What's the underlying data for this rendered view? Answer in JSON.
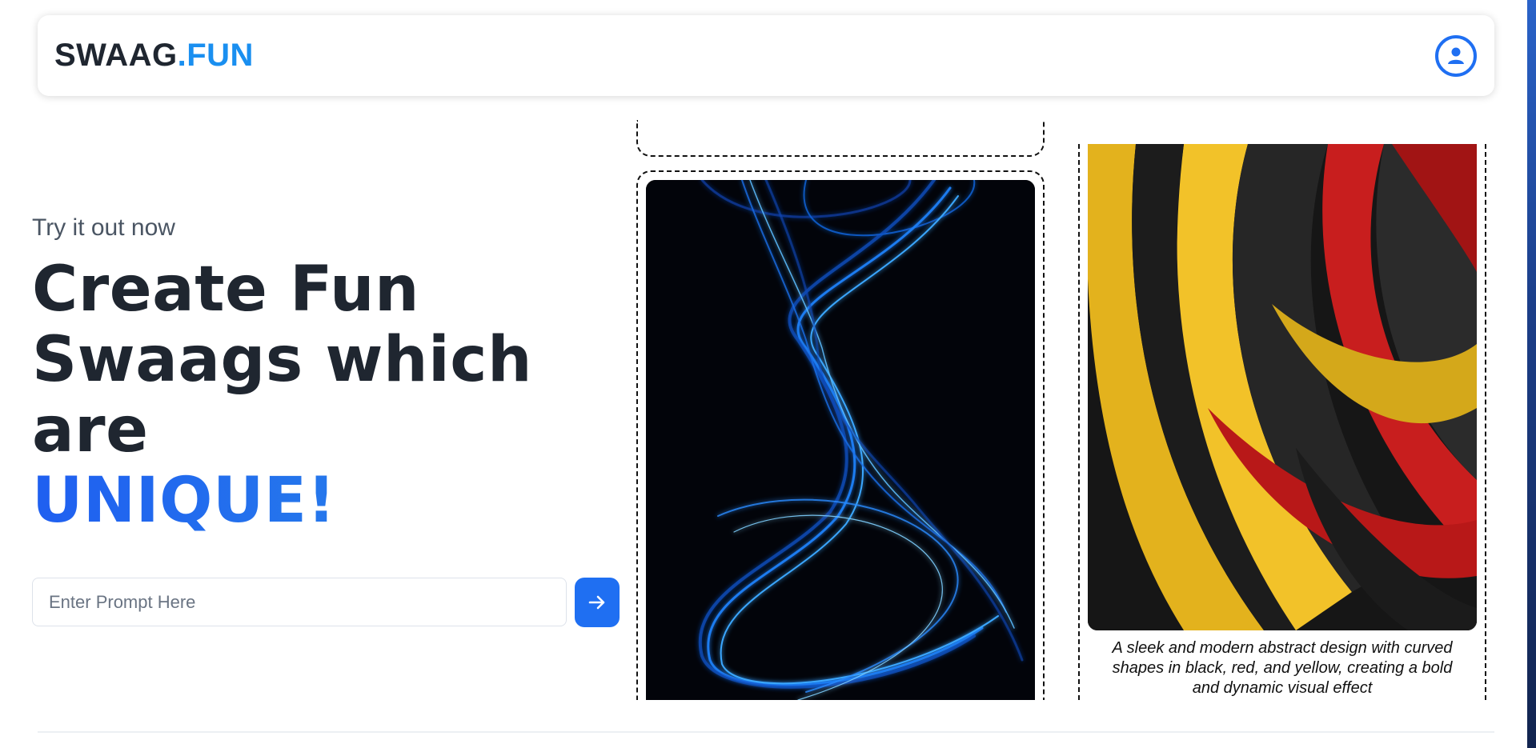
{
  "header": {
    "logo_main": "SWAAG",
    "logo_accent": ".FUN",
    "user_icon": "user-circle-icon"
  },
  "hero": {
    "eyebrow": "Try it out now",
    "headline_lines": [
      "Create Fun",
      "Swaags which",
      "are"
    ],
    "headline_accent": "UNIQUE!",
    "prompt_placeholder": "Enter Prompt Here",
    "submit_icon": "arrow-right-icon"
  },
  "gallery": {
    "cards": [
      {
        "image": "blue-light-swirl-art",
        "caption": ""
      },
      {
        "image": "black-red-yellow-abstract-art",
        "caption": "A sleek and modern abstract design with curved shapes in black, red, and yellow, creating a bold and dynamic visual effect"
      }
    ]
  },
  "colors": {
    "accent": "#1f6ff2",
    "logo_accent": "#1a8ff0",
    "text": "#1f2630"
  }
}
